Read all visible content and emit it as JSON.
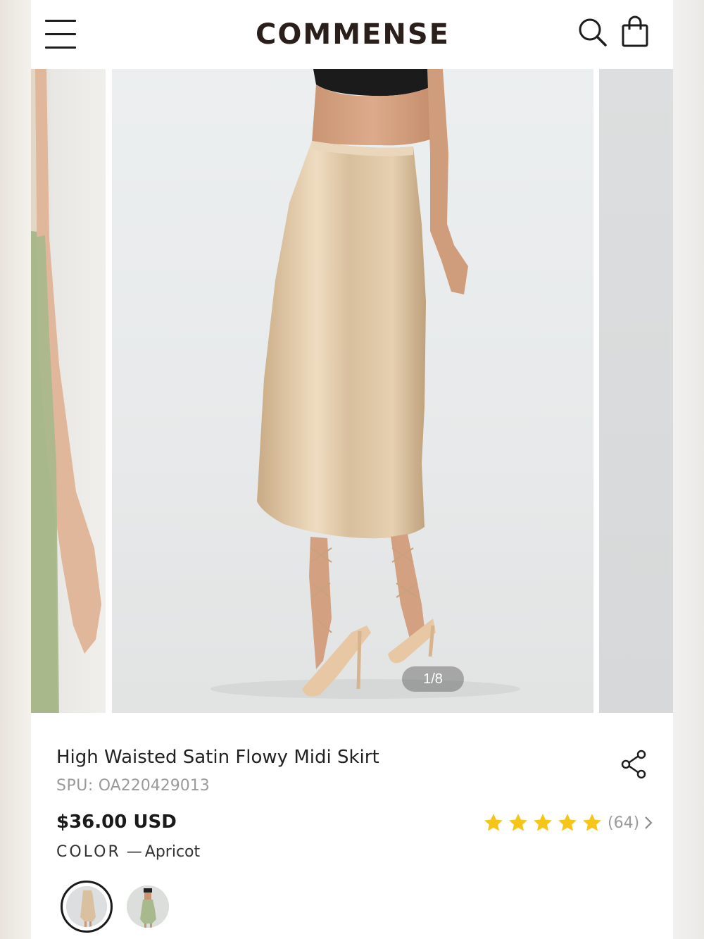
{
  "header": {
    "brand": "COMMENSE",
    "icons": [
      "menu-icon",
      "search-icon",
      "shopping-bag-icon"
    ]
  },
  "carousel": {
    "pager_text": "1/8",
    "current": 1,
    "total": 8
  },
  "product": {
    "title": "High Waisted Satin Flowy Midi Skirt",
    "spu_label": "SPU:",
    "spu_value": "OA220429013",
    "price": "$36.00 USD",
    "rating": {
      "stars": 5,
      "review_count": "(64)"
    },
    "color_label": "COLOR",
    "color_separator": "—",
    "color_value": "Apricot",
    "swatches": [
      {
        "name": "Apricot",
        "selected": true
      },
      {
        "name": "Green",
        "selected": false
      }
    ]
  },
  "colors": {
    "brand_text": "#2b1f1c",
    "star": "#f5c518",
    "skirt_apricot": "#d9c0a0",
    "skirt_green": "#a9b98e"
  }
}
